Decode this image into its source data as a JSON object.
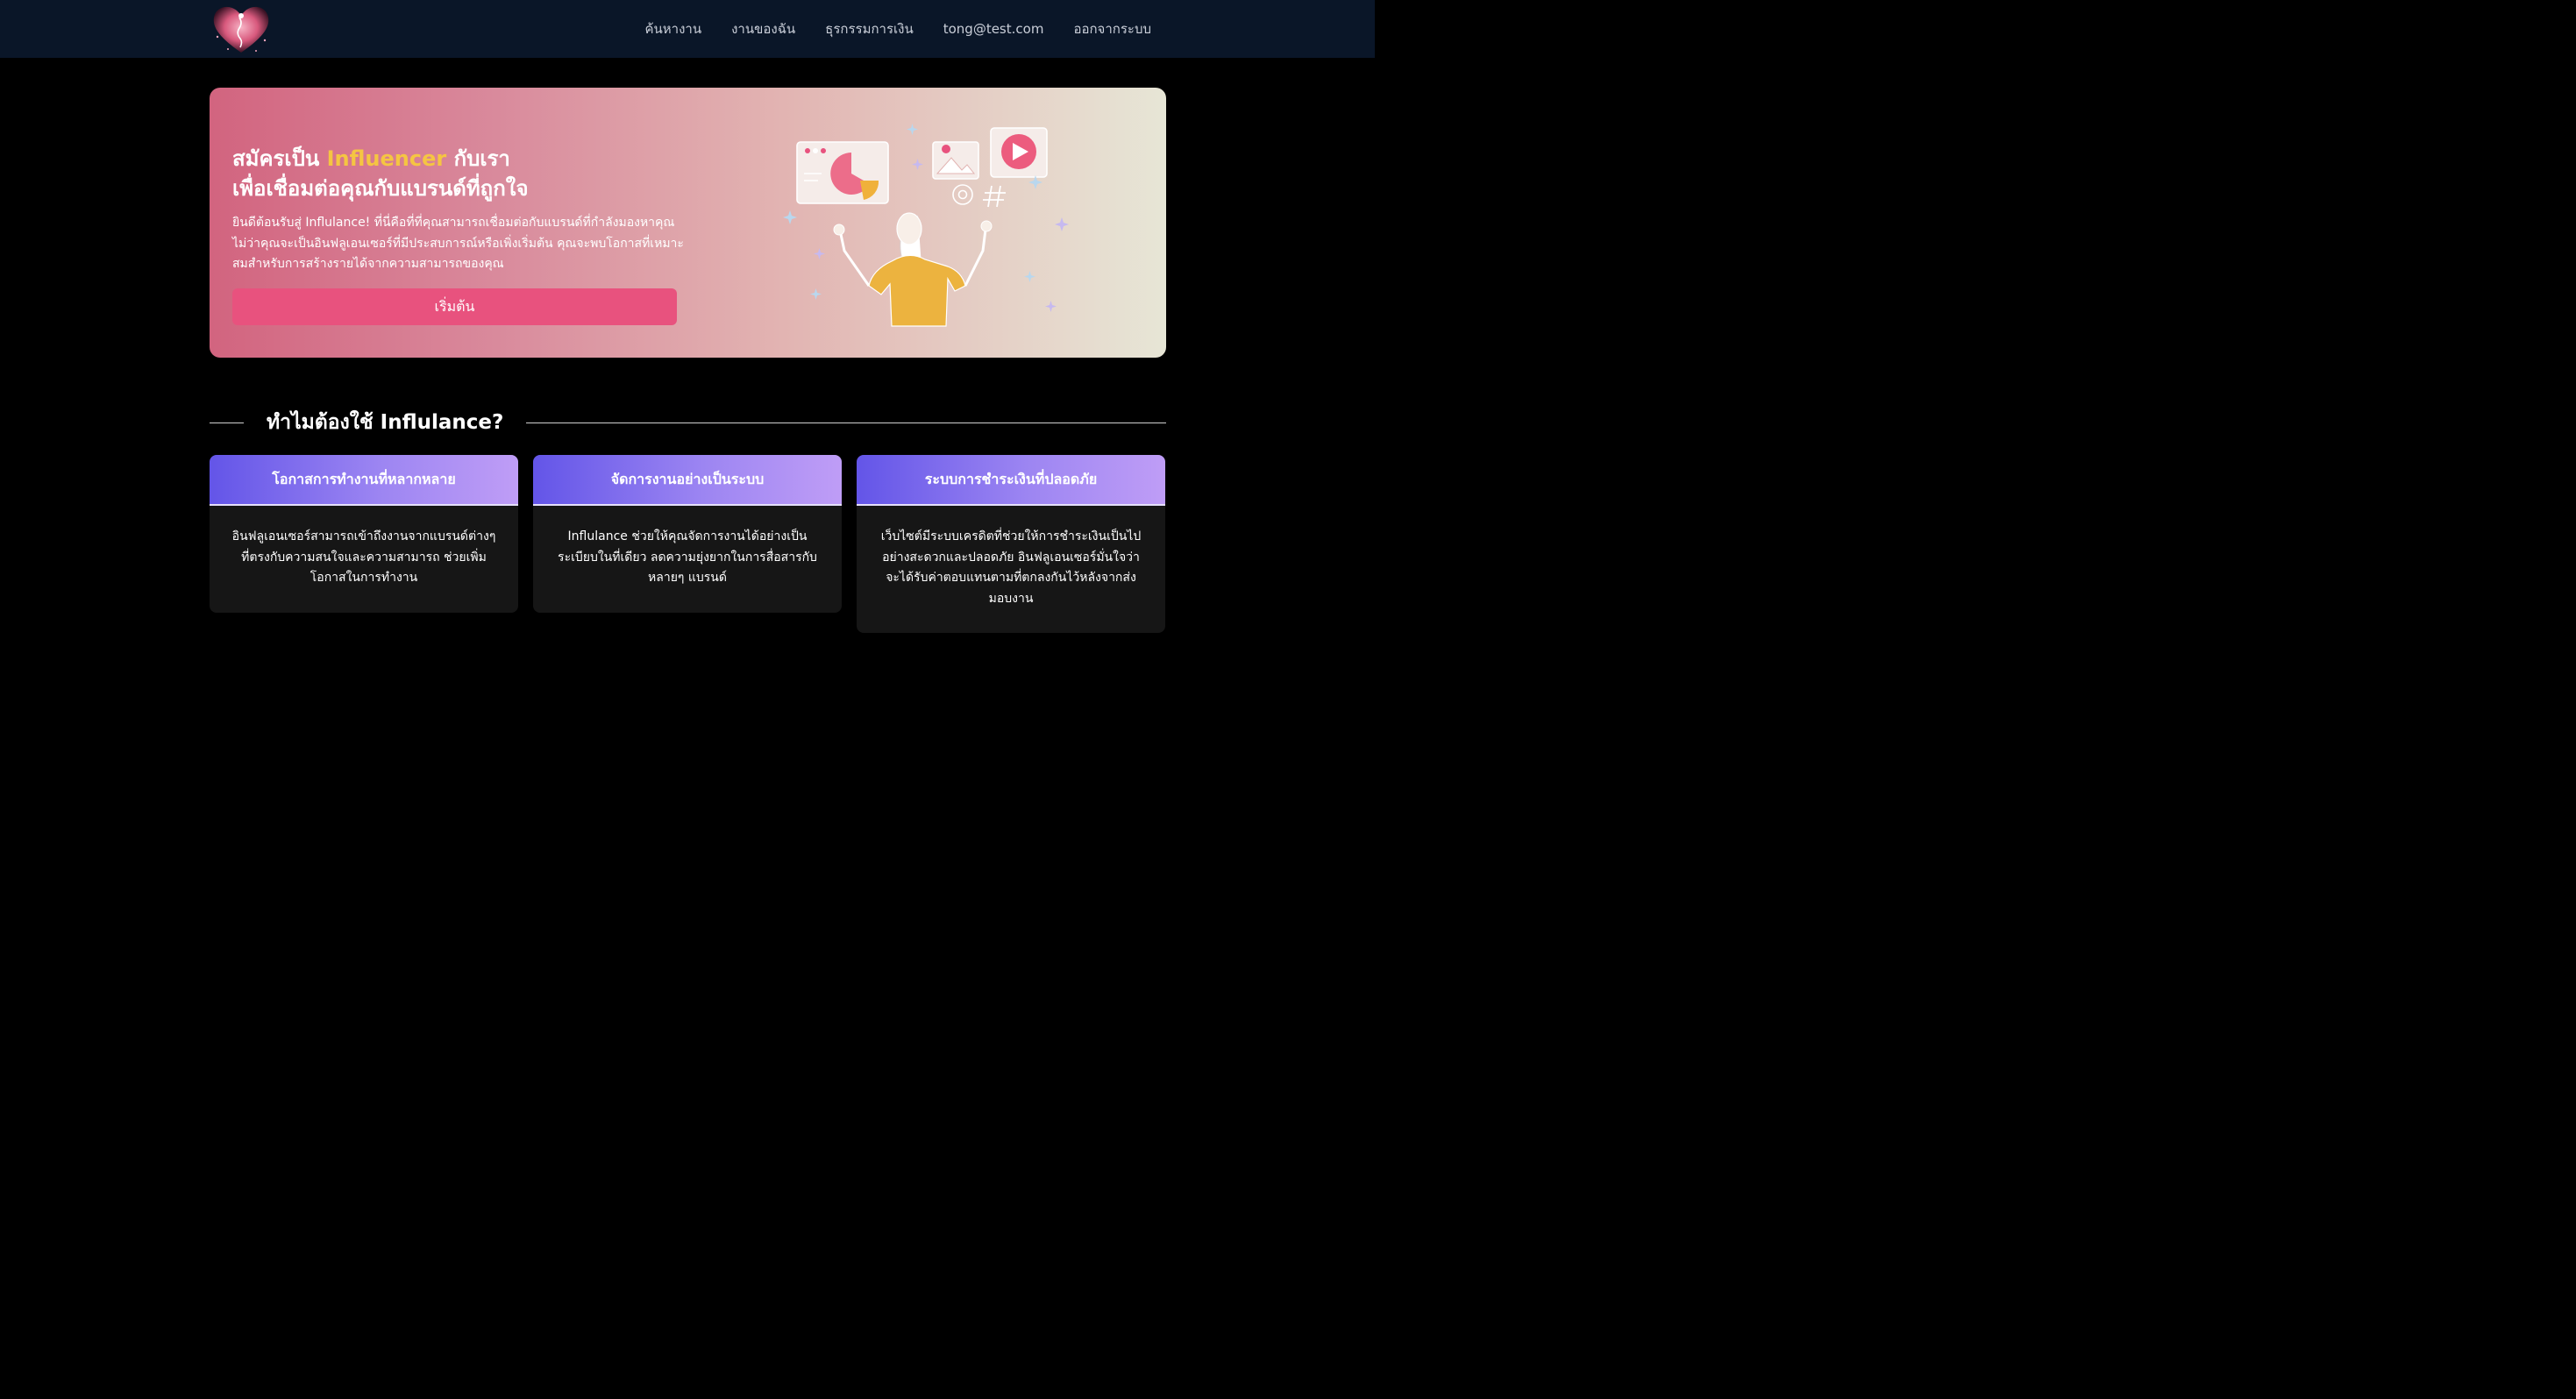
{
  "nav": {
    "links": [
      "ค้นหางาน",
      "งานของฉัน",
      "ธุรกรรมการเงิน",
      "tong@test.com",
      "ออกจากระบบ"
    ]
  },
  "hero": {
    "title_prefix": "สมัครเป็น ",
    "title_accent": "Influencer",
    "title_suffix": " กับเรา",
    "title_line2": "เพื่อเชื่อมต่อคุณกับแบรนด์ที่ถูกใจ",
    "description": "ยินดีต้อนรับสู่ Influlance! ที่นี่คือที่ที่คุณสามารถเชื่อมต่อกับแบรนด์ที่กำลังมองหาคุณ ไม่ว่าคุณจะเป็นอินฟลูเอนเซอร์ที่มีประสบการณ์หรือเพิ่งเริ่มต้น คุณจะพบโอกาสที่เหมาะสมสำหรับการสร้างรายได้จากความสามารถของคุณ",
    "button_label": "เริ่มต้น"
  },
  "why": {
    "title": "ทำไมต้องใช้ Influlance?"
  },
  "features": [
    {
      "title": "โอกาสการทำงานที่หลากหลาย",
      "body": "อินฟลูเอนเซอร์สามารถเข้าถึงงานจากแบรนด์ต่างๆ ที่ตรงกับความสนใจและความสามารถ ช่วยเพิ่มโอกาสในการทำงาน"
    },
    {
      "title": "จัดการงานอย่างเป็นระบบ",
      "body": "Influlance ช่วยให้คุณจัดการงานได้อย่างเป็นระเบียบในที่เดียว ลดความยุ่งยากในการสื่อสารกับหลายๆ แบรนด์"
    },
    {
      "title": "ระบบการชำระเงินที่ปลอดภัย",
      "body": "เว็บไซต์มีระบบเครดิตที่ช่วยให้การชำระเงินเป็นไปอย่างสะดวกและปลอดภัย อินฟลูเอนเซอร์มั่นใจว่าจะได้รับค่าตอบแทนตามที่ตกลงกันไว้หลังจากส่งมอบงาน"
    }
  ],
  "colors": {
    "navbar": "#0a1628",
    "accent_yellow": "#f5c542",
    "button_pink": "#e8527e",
    "card_header_start": "#6355e8",
    "card_header_end": "#bf9df6"
  },
  "icons": [
    "heart-logo-icon",
    "pie-chart-icon",
    "play-icon",
    "image-icon",
    "at-sign-icon",
    "hashtag-icon",
    "sparkle-icon"
  ]
}
